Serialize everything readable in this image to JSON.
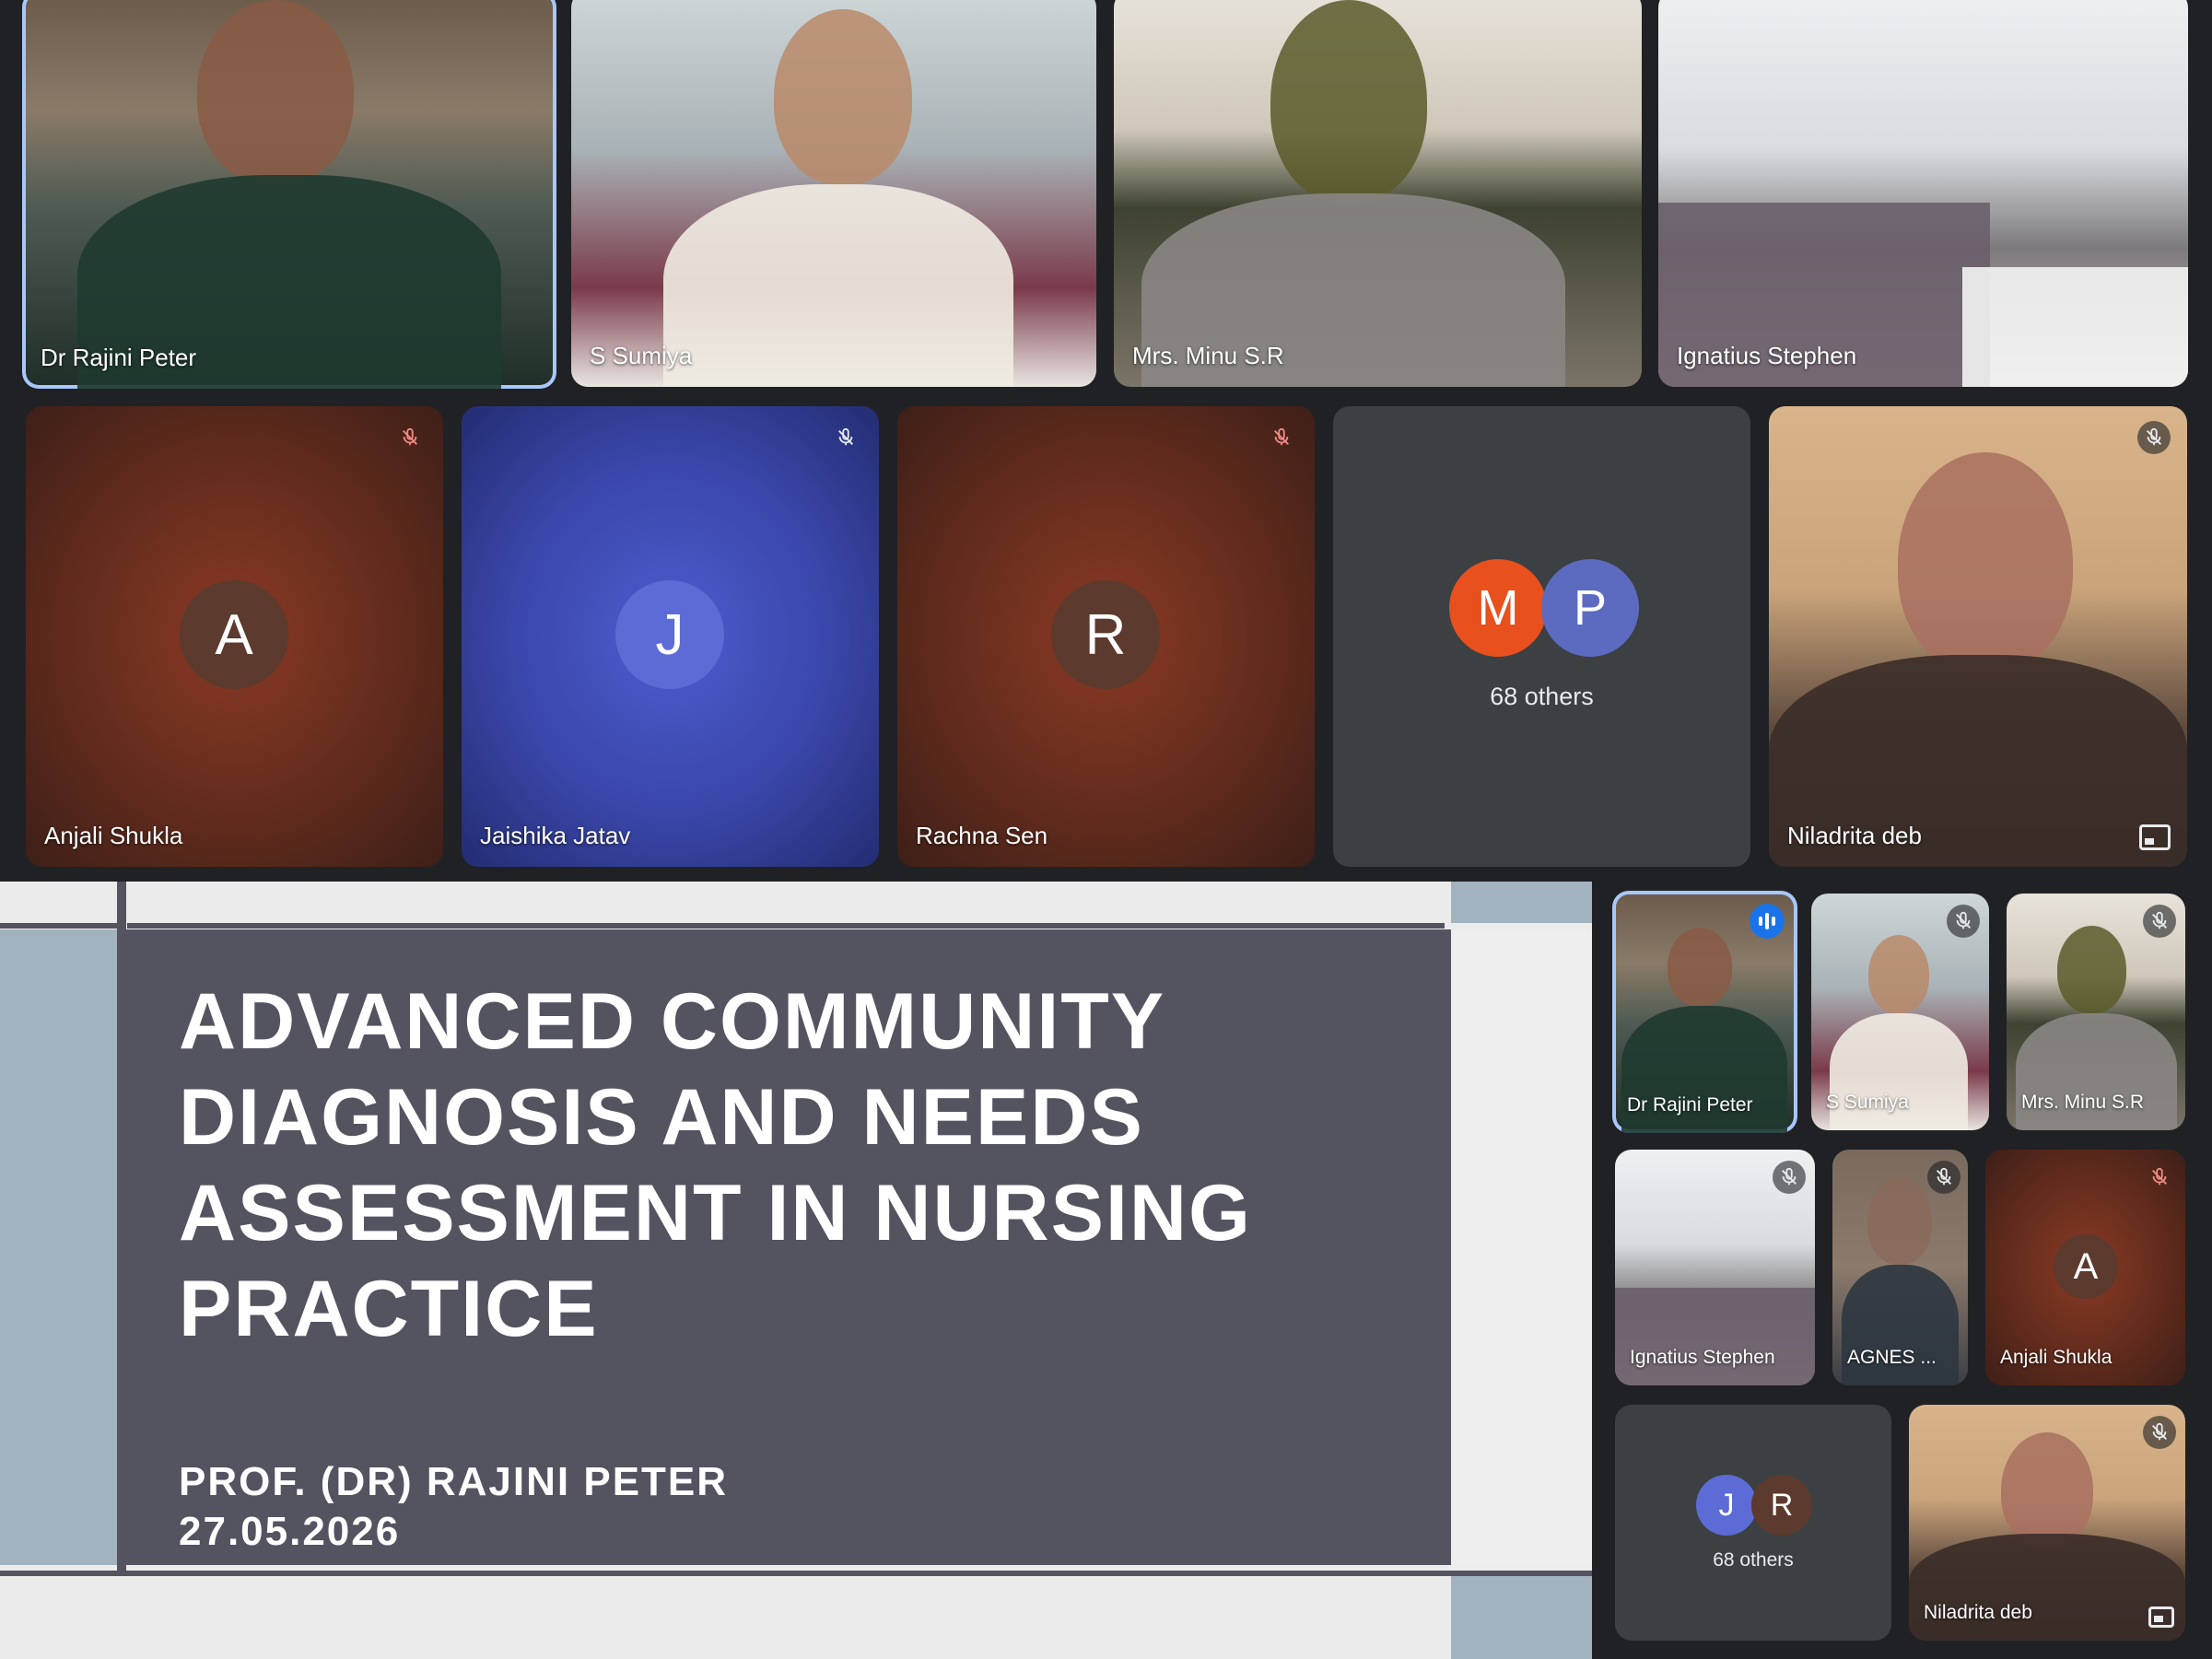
{
  "top_row": [
    {
      "name": "Dr Rajini Peter"
    },
    {
      "name": "S Sumiya"
    },
    {
      "name": "Mrs. Minu S.R"
    },
    {
      "name": "Ignatius Stephen"
    }
  ],
  "middle_row": [
    {
      "name": "Anjali Shukla",
      "initial": "A",
      "avatar_color": "#5c3a2e"
    },
    {
      "name": "Jaishika Jatav",
      "initial": "J",
      "avatar_color": "#5c6bd6"
    },
    {
      "name": "Rachna Sen",
      "initial": "R",
      "avatar_color": "#5c3a2e"
    },
    {
      "others_label": "68 others",
      "avatars": [
        {
          "initial": "M",
          "color": "#e8501d"
        },
        {
          "initial": "P",
          "color": "#5c6bc0"
        }
      ]
    },
    {
      "name": "Niladrita deb"
    }
  ],
  "slide": {
    "title": "ADVANCED COMMUNITY DIAGNOSIS AND NEEDS ASSESSMENT IN NURSING PRACTICE",
    "presenter": "PROF. (DR) RAJINI PETER",
    "date": "27.05.2026"
  },
  "side_grid": [
    {
      "name": "Dr Rajini Peter"
    },
    {
      "name": "S Sumiya"
    },
    {
      "name": "Mrs. Minu S.R"
    },
    {
      "name": "Ignatius Stephen"
    },
    {
      "name": "AGNES ..."
    },
    {
      "name": "Anjali Shukla",
      "initial": "A"
    },
    {
      "others_label": "68 others",
      "avatars": [
        {
          "initial": "J",
          "color": "#5c6bd6"
        },
        {
          "initial": "R",
          "color": "#5c3a2e"
        }
      ]
    },
    {
      "name": "Niladrita deb"
    }
  ],
  "colors": {
    "active_border": "#a8c7fa",
    "mic_off_red": "#f28b82",
    "background": "#202124"
  }
}
